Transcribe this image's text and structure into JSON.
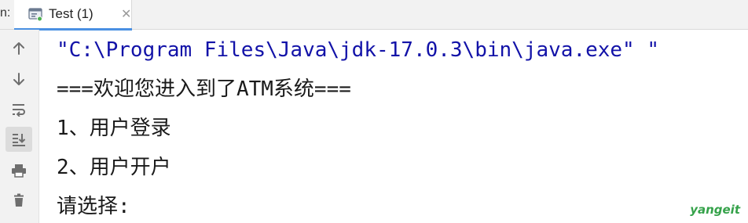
{
  "tabbar": {
    "prefix": "n:",
    "tab": {
      "label": "Test (1)",
      "close_glyph": "✕",
      "icon": "run-console-icon"
    }
  },
  "gutter": {
    "tools": [
      {
        "icon": "arrow-up-icon",
        "active": false
      },
      {
        "icon": "arrow-down-icon",
        "active": false
      },
      {
        "icon": "soft-wrap-icon",
        "active": false
      },
      {
        "icon": "scroll-to-end-icon",
        "active": true
      },
      {
        "icon": "print-icon",
        "active": false
      },
      {
        "icon": "trash-icon",
        "active": false
      }
    ]
  },
  "console": {
    "lines": [
      "\"C:\\Program Files\\Java\\jdk-17.0.3\\bin\\java.exe\" \"",
      "===欢迎您进入到了ATM系统===",
      "1、用户登录",
      "2、用户开户",
      "请选择:"
    ]
  },
  "watermark": "yangeit",
  "colors": {
    "command_text": "#1212a8",
    "output_text": "#1a1a1a",
    "tab_underline": "#4a90e2",
    "watermark": "#35a24a"
  }
}
